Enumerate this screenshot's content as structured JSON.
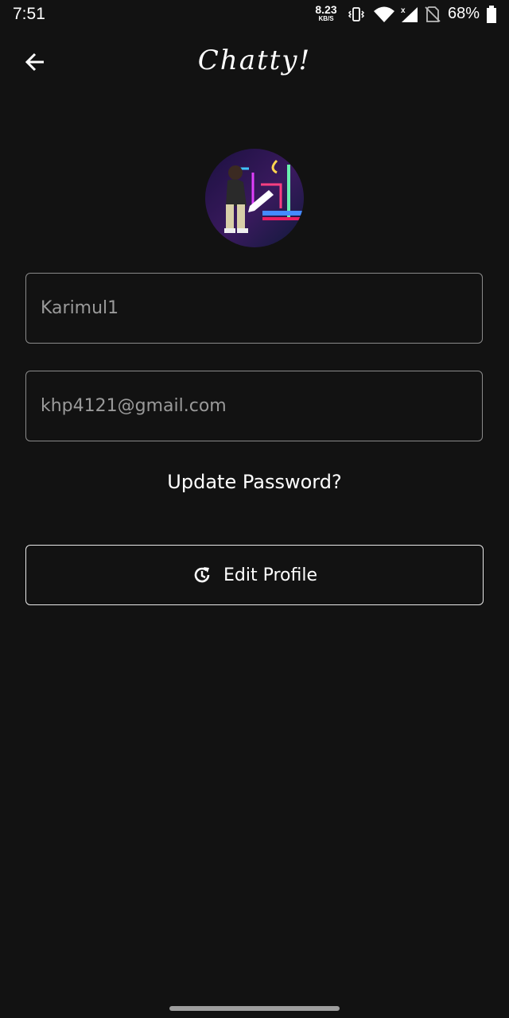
{
  "status_bar": {
    "time": "7:51",
    "net_speed_value": "8.23",
    "net_speed_unit": "KB/S",
    "battery_percent": "68%"
  },
  "app_bar": {
    "title": "Chatty!",
    "back_icon": "arrow-back-icon"
  },
  "profile": {
    "avatar_edit_icon": "pencil-icon",
    "username_value": "Karimul1",
    "email_value": "khp4121@gmail.com"
  },
  "actions": {
    "update_password_label": "Update Password?",
    "edit_profile_label": "Edit Profile",
    "edit_profile_icon": "refresh-icon"
  },
  "colors": {
    "background": "#121212",
    "field_border": "#8a8a8a",
    "field_text": "#9a9a9a",
    "button_border": "#e8e8e8",
    "text": "#ffffff"
  }
}
